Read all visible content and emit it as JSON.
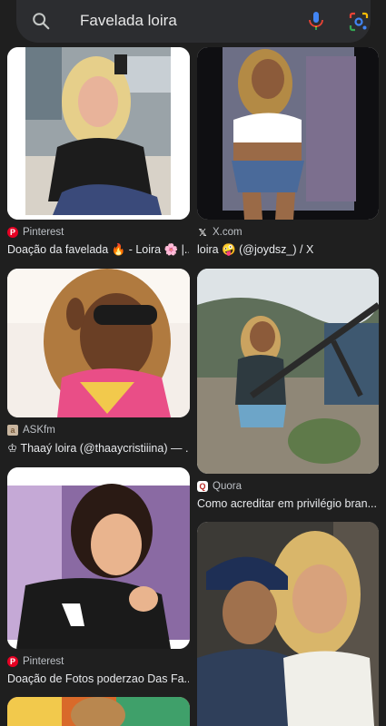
{
  "search": {
    "query": "Favelada loira"
  },
  "colors": {
    "background": "#1f1f1f",
    "searchbar": "#2c2d30",
    "pinterest": "#e60023",
    "quora": "#b92b27"
  },
  "results": [
    {
      "source": "Pinterest",
      "source_icon": "pinterest-icon",
      "title": "Doação da favelada 🔥 - Loira 🌸 |..."
    },
    {
      "source": "X.com",
      "source_icon": "x-icon",
      "title": "loira 🤪 (@joydsz_) / X"
    },
    {
      "source": "ASKfm",
      "source_icon": "askfm-icon",
      "title": "♔ Thaaý loira (@thaaycristiiina) — ..."
    },
    {
      "source": "Quora",
      "source_icon": "quora-icon",
      "title": "Como acreditar em privilégio bran..."
    },
    {
      "source": "Pinterest",
      "source_icon": "pinterest-icon",
      "title": "Doação de Fotos poderzao Das Fa..."
    }
  ]
}
